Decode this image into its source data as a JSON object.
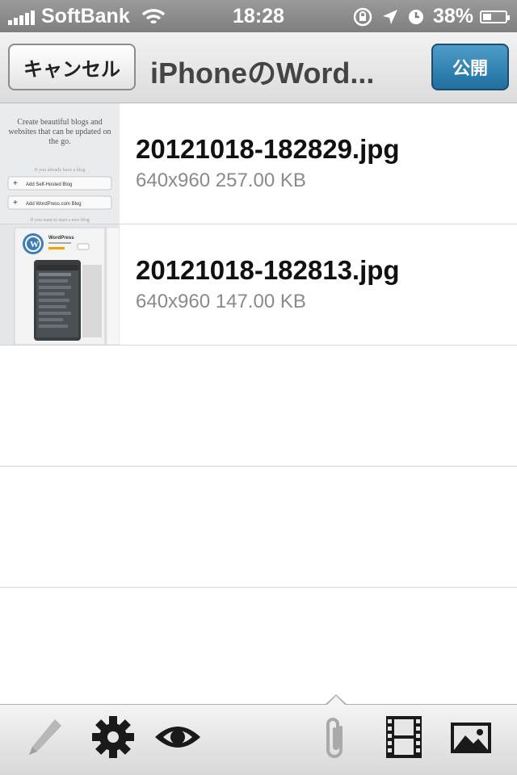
{
  "status_bar": {
    "carrier": "SoftBank",
    "time": "18:28",
    "battery": "38%",
    "battery_level": 0.38
  },
  "nav": {
    "cancel_label": "キャンセル",
    "title": "iPhoneのWord...",
    "publish_label": "公開"
  },
  "media_list": {
    "items": [
      {
        "filename": "20121018-182829.jpg",
        "meta": "640x960 257.00 KB"
      },
      {
        "filename": "20121018-182813.jpg",
        "meta": "640x960 147.00 KB"
      }
    ],
    "thumb_text": {
      "headline": "Create beautiful blogs and websites that can be updated on the go.",
      "subtext": "If you already have a blog",
      "button1": "Add Self-Hosted Blog",
      "button2": "Add WordPress.com Blog",
      "subtext2": "If you want to start a new blog",
      "app_name": "WordPress"
    }
  },
  "toolbar": {
    "icons": [
      "pencil-icon",
      "gear-icon",
      "eye-icon",
      "paperclip-icon",
      "film-icon",
      "image-icon"
    ]
  }
}
